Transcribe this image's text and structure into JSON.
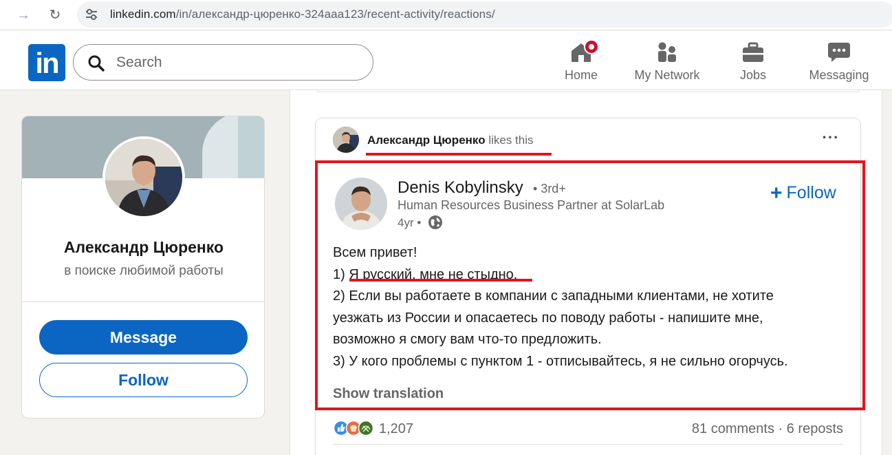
{
  "browser": {
    "url_host": "linkedin.com",
    "url_path": "/in/александр-цюренко-324aaa123/recent-activity/reactions/"
  },
  "nav": {
    "logo": "in",
    "search_placeholder": "Search",
    "items": [
      {
        "label": "Home",
        "icon": "home-icon",
        "notification": true
      },
      {
        "label": "My Network",
        "icon": "people-icon"
      },
      {
        "label": "Jobs",
        "icon": "briefcase-icon"
      },
      {
        "label": "Messaging",
        "icon": "chat-bubble-icon"
      }
    ]
  },
  "profile": {
    "name": "Александр Цюренко",
    "headline": "в поиске любимой работы",
    "message_label": "Message",
    "follow_label": "Follow"
  },
  "post": {
    "actor_name": "Александр Цюренко",
    "actor_action": "likes this",
    "author": {
      "name": "Denis Kobylinsky",
      "degree": "• 3rd+",
      "headline": "Human Resources Business Partner at SolarLab",
      "age": "4yr •"
    },
    "follow_label": "Follow",
    "body_lines": [
      "Всем привет!",
      "1) Я русский, мне не стыдно.",
      "2) Если вы работаете в компании с западными клиентами, не хотите",
      "уезжать из России и опасаетесь по поводу работы - напишите мне,",
      "возможно я смогу вам что-то предложить.",
      "3) У кого проблемы с пунктом 1 - отписывайтесь, я не сильно огорчусь."
    ],
    "show_translation": "Show translation",
    "reactions_count": "1,207",
    "social_counts": "81 comments · 6 reposts"
  },
  "colors": {
    "brand_blue": "#0a66c2",
    "highlight_red": "#e3141e",
    "notification_red": "#cb112d"
  }
}
